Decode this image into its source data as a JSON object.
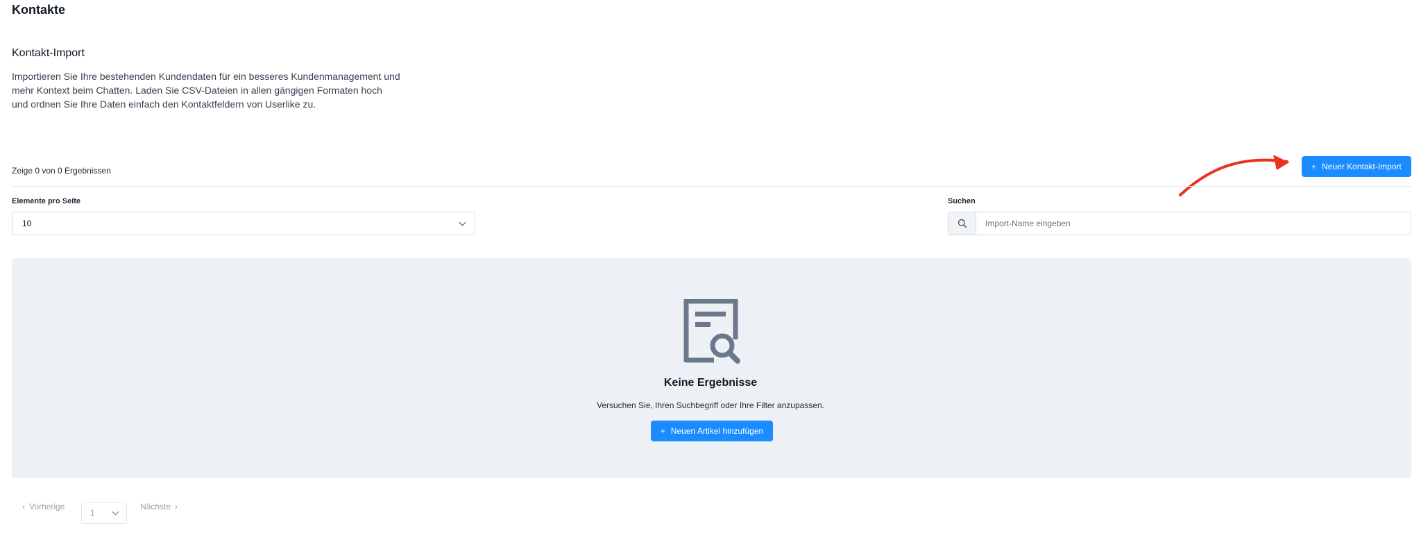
{
  "page": {
    "title": "Kontakte"
  },
  "section": {
    "title": "Kontakt-Import",
    "description": "Importieren Sie Ihre bestehenden Kundendaten für ein besseres Kundenmanagement und mehr Kontext beim Chatten. Laden Sie CSV-Dateien in allen gängigen Formaten hoch und ordnen Sie Ihre Daten einfach den Kontaktfeldern von Userlike zu."
  },
  "toolbar": {
    "results_text": "Zeige 0 von 0 Ergebnissen",
    "new_import_label": "Neuer Kontakt-Import",
    "plus": "+"
  },
  "filters": {
    "per_page_label": "Elemente pro Seite",
    "per_page_value": "10",
    "search_label": "Suchen",
    "search_placeholder": "Import-Name eingeben"
  },
  "empty_state": {
    "icon": "document-search-icon",
    "title": "Keine Ergebnisse",
    "text": "Versuchen Sie, Ihren Suchbegriff oder Ihre Filter anzupassen.",
    "button_label": "Neuen Artikel hinzufügen",
    "plus": "+"
  },
  "pagination": {
    "prev_label": "Vorherige",
    "next_label": "Nächste",
    "current_page": "1",
    "prev_arrow": "‹",
    "next_arrow": "›"
  },
  "colors": {
    "primary": "#1a8cff",
    "annotation_arrow": "#e8321e",
    "empty_bg": "#edf1f5",
    "icon": "#6b778c"
  }
}
